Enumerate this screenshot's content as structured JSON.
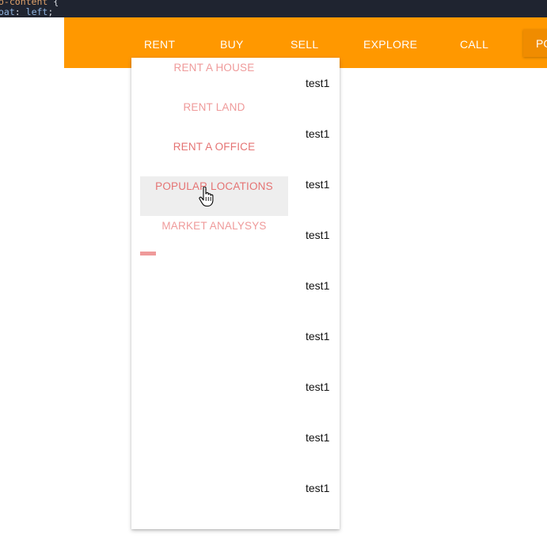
{
  "code": {
    "line1": {
      "selector": "o-content",
      "punct": " {"
    },
    "line2": {
      "property": "oat",
      "sep": ": ",
      "value": "left",
      "end": ";"
    }
  },
  "nav": {
    "items": [
      {
        "label": "RENT"
      },
      {
        "label": "BUY"
      },
      {
        "label": "SELL"
      },
      {
        "label": "EXPLORE"
      },
      {
        "label": "CALL"
      }
    ],
    "highlight_label": "PO"
  },
  "dropdown": {
    "items": [
      {
        "label": "RENT A HOUSE"
      },
      {
        "label": "RENT LAND"
      },
      {
        "label": "RENT A OFFICE"
      },
      {
        "label": "POPULAR LOCATIONS"
      },
      {
        "label": "MARKET ANALYSYS"
      }
    ],
    "side_items": [
      "test1",
      "test1",
      "test1",
      "test1",
      "test1",
      "test1",
      "test1",
      "test1",
      "test1"
    ]
  },
  "colors": {
    "navbar": "#ff9800",
    "nav_highlight": "#f08c00",
    "dropdown_text": "#ef9a9a",
    "dropdown_hover_bg": "#eeeeee",
    "code_bg": "#1f2430"
  },
  "icons": {
    "cursor": "hand-pointer-icon"
  }
}
